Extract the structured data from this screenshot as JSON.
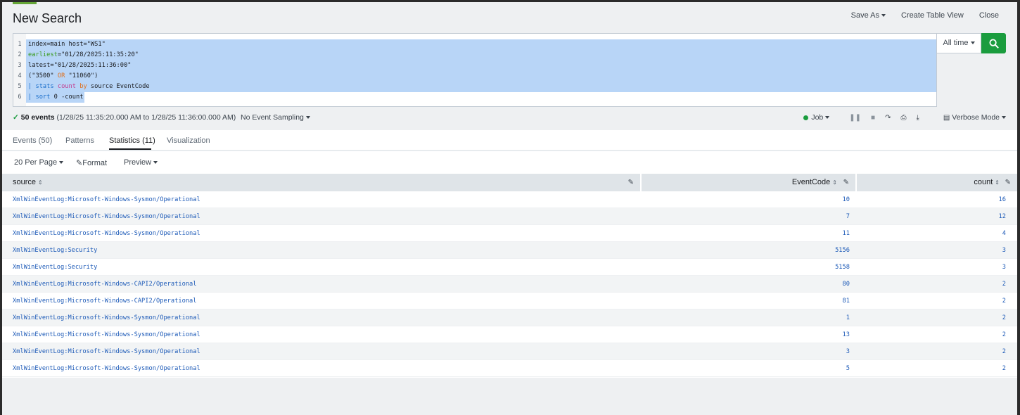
{
  "header": {
    "title": "New Search",
    "save_as": "Save As",
    "create_table_view": "Create Table View",
    "close": "Close"
  },
  "search": {
    "lines": [
      {
        "num": "1"
      },
      {
        "num": "2"
      },
      {
        "num": "3"
      },
      {
        "num": "4"
      },
      {
        "num": "5"
      },
      {
        "num": "6"
      }
    ],
    "tokens": {
      "l1": "index=main host=\"WS1\"",
      "l2_kw": "earliest",
      "l2_val": "=\"01/28/2025:11:35:20\"",
      "l3": "latest=\"01/28/2025:11:36:00\"",
      "l4_a": "(\"3500\" ",
      "l4_or": "OR",
      "l4_b": " \"11060\")",
      "l5_pipe": "| stats ",
      "l5_count": "count",
      "l5_by": " by",
      "l5_rest": " source EventCode",
      "l6_pipe": "| sort",
      "l6_rest": " 0 -count"
    },
    "time_range": "All time"
  },
  "status": {
    "check": "✓",
    "events": "50 events",
    "range": "(1/28/25 11:35:20.000 AM to 1/28/25 11:36:00.000 AM)",
    "sampling": "No Event Sampling",
    "job": "Job",
    "mode": "Verbose Mode"
  },
  "tabs": [
    {
      "label": "Events (50)"
    },
    {
      "label": "Patterns"
    },
    {
      "label": "Statistics (11)"
    },
    {
      "label": "Visualization"
    }
  ],
  "toolbar": {
    "per_page": "20 Per Page",
    "format": "Format",
    "preview": "Preview"
  },
  "table": {
    "columns": [
      "source",
      "EventCode",
      "count"
    ],
    "rows": [
      {
        "source": "XmlWinEventLog:Microsoft-Windows-Sysmon/Operational",
        "EventCode": "10",
        "count": "16"
      },
      {
        "source": "XmlWinEventLog:Microsoft-Windows-Sysmon/Operational",
        "EventCode": "7",
        "count": "12"
      },
      {
        "source": "XmlWinEventLog:Microsoft-Windows-Sysmon/Operational",
        "EventCode": "11",
        "count": "4"
      },
      {
        "source": "XmlWinEventLog:Security",
        "EventCode": "5156",
        "count": "3"
      },
      {
        "source": "XmlWinEventLog:Security",
        "EventCode": "5158",
        "count": "3"
      },
      {
        "source": "XmlWinEventLog:Microsoft-Windows-CAPI2/Operational",
        "EventCode": "80",
        "count": "2"
      },
      {
        "source": "XmlWinEventLog:Microsoft-Windows-CAPI2/Operational",
        "EventCode": "81",
        "count": "2"
      },
      {
        "source": "XmlWinEventLog:Microsoft-Windows-Sysmon/Operational",
        "EventCode": "1",
        "count": "2"
      },
      {
        "source": "XmlWinEventLog:Microsoft-Windows-Sysmon/Operational",
        "EventCode": "13",
        "count": "2"
      },
      {
        "source": "XmlWinEventLog:Microsoft-Windows-Sysmon/Operational",
        "EventCode": "3",
        "count": "2"
      },
      {
        "source": "XmlWinEventLog:Microsoft-Windows-Sysmon/Operational",
        "EventCode": "5",
        "count": "2"
      }
    ]
  },
  "colors": {
    "accent": "#65a637",
    "search_button": "#1a9c3e",
    "link": "#1e5bb8",
    "selection": "#b8d5f7"
  }
}
